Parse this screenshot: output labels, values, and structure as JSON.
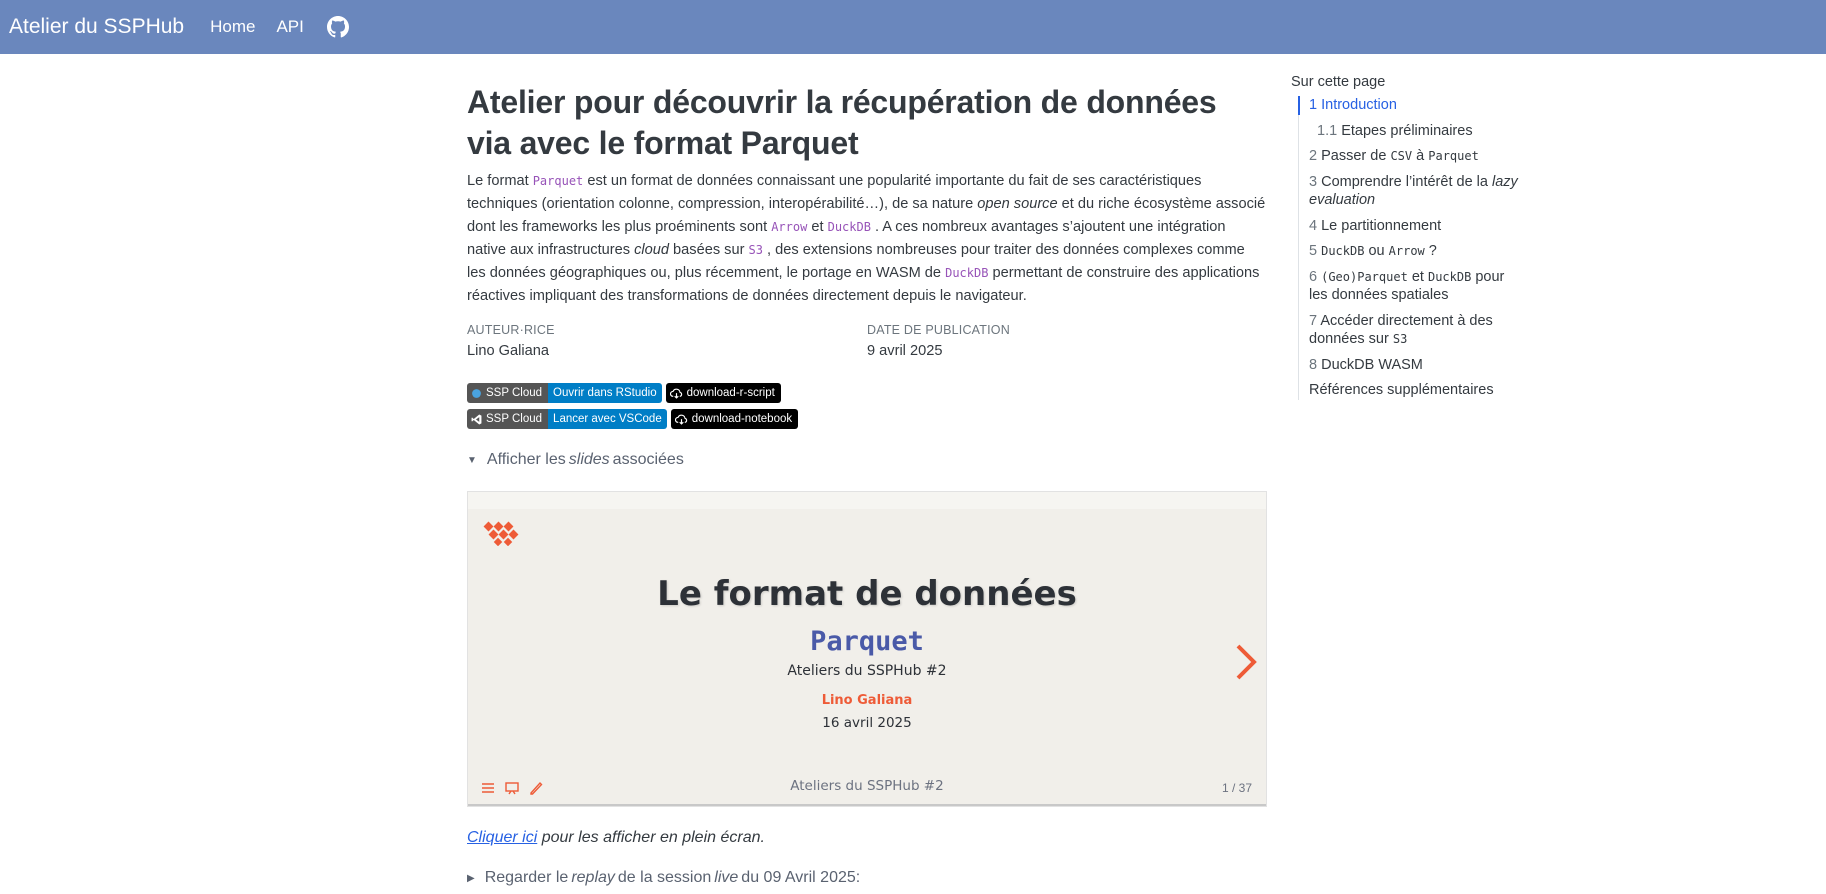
{
  "navbar": {
    "brand": "Atelier du SSPHub",
    "links": [
      "Home",
      "API"
    ],
    "github_icon": "github-icon",
    "bg_color": "#6a87bd"
  },
  "main": {
    "title": "Atelier pour découvrir la récupération de données via avec le format Parquet",
    "intro": {
      "p1": "Le format ",
      "c1": "Parquet",
      "p2": " est un format de données connaissant une popularité importante du fait de ses caractéristiques techniques (orientation colonne, compression, interopérabilité…), de sa nature ",
      "i1": "open source",
      "p3": " et du riche écosystème associé dont les frameworks les plus proéminents sont ",
      "c2": "Arrow",
      "p4": " et ",
      "c3": "DuckDB",
      "p5": " . A ces nombreux avantages s’ajoutent une intégration native aux infrastructures ",
      "i2": "cloud",
      "p6": " basées sur ",
      "c4": "S3",
      "p7": " , des extensions nombreuses pour traiter des données complexes comme les données géographiques ou, plus récemment, le portage en WASM de ",
      "c5": "DuckDB",
      "p8": " permettant de construire des applications réactives impliquant des transformations de données directement depuis le navigateur."
    },
    "meta": {
      "author_label": "Auteur·rice",
      "author": "Lino Galiana",
      "date_label": "Date de publication",
      "date": "9 avril 2025"
    },
    "badges": {
      "row1": {
        "left": "SSP Cloud",
        "right": "Ouvrir dans RStudio",
        "download": "download-r-script"
      },
      "row2": {
        "left": "SSP Cloud",
        "right": "Lancer avec VSCode",
        "download": "download-notebook"
      }
    },
    "slides_toggle": {
      "prefix": "Afficher les ",
      "italic": "slides",
      "suffix": " associées"
    },
    "slide": {
      "title": "Le format de données",
      "subtitle": "Parquet",
      "event": "Ateliers du SSPHub #2",
      "author": "Lino Galiana",
      "date": "16 avril 2025",
      "footer": "Ateliers du SSPHub #2",
      "page": "1 / 37",
      "accent": "#ee5b37"
    },
    "fullscreen": {
      "link": "Cliquer ici",
      "text": " pour les afficher en plein écran."
    },
    "replay": {
      "p1": "Regarder le ",
      "i1": "replay",
      "p2": " de la session ",
      "i2": "live",
      "p3": " du 09 Avril 2025:"
    }
  },
  "toc": {
    "title": "Sur cette page",
    "items": [
      {
        "num": "1",
        "label": "Introduction"
      },
      {
        "num": "1.1",
        "label": "Etapes préliminaires"
      },
      {
        "num": "2",
        "a": "Passer de ",
        "c1": "CSV",
        "b": " à ",
        "c2": "Parquet"
      },
      {
        "num": "3",
        "a": "Comprendre l’intérêt de la ",
        "i": "lazy evaluation"
      },
      {
        "num": "4",
        "label": "Le partitionnement"
      },
      {
        "num": "5",
        "c1": "DuckDB",
        "a": " ou ",
        "c2": "Arrow",
        "b": " ?"
      },
      {
        "num": "6",
        "c1": "(Geo)Parquet",
        "a": " et ",
        "c2": "DuckDB",
        "b": " pour les données spatiales"
      },
      {
        "num": "7",
        "a": "Accéder directement à des données sur ",
        "c1": "S3"
      },
      {
        "num": "8",
        "label": "DuckDB WASM"
      },
      {
        "label": "Références supplémentaires"
      }
    ]
  }
}
